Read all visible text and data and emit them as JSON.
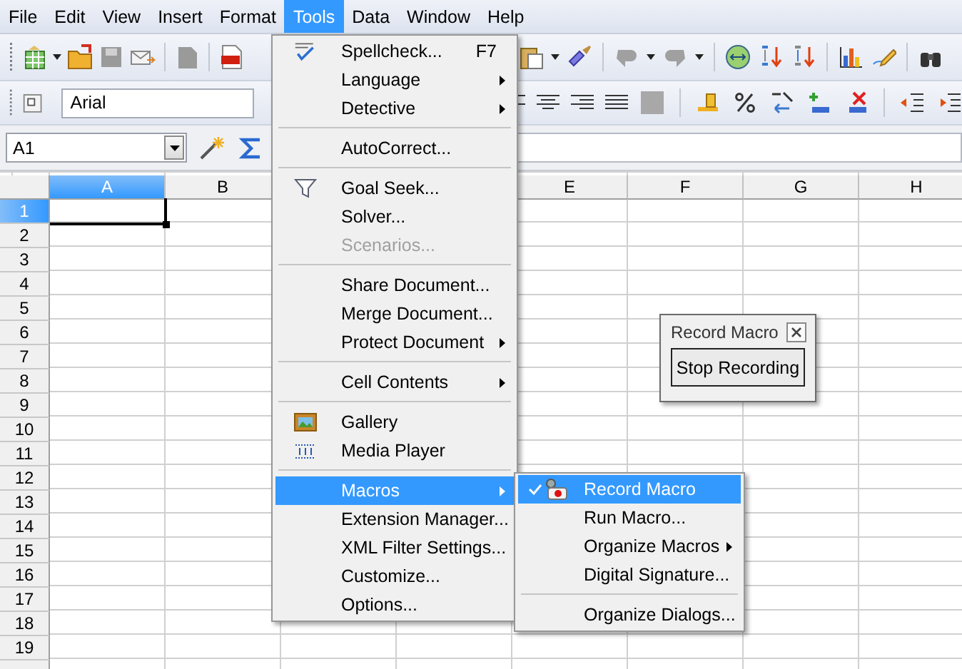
{
  "menubar": [
    {
      "label": "File",
      "selected": false
    },
    {
      "label": "Edit",
      "selected": false
    },
    {
      "label": "View",
      "selected": false
    },
    {
      "label": "Insert",
      "selected": false
    },
    {
      "label": "Format",
      "selected": false
    },
    {
      "label": "Tools",
      "selected": true
    },
    {
      "label": "Data",
      "selected": false
    },
    {
      "label": "Window",
      "selected": false
    },
    {
      "label": "Help",
      "selected": false
    }
  ],
  "font_field": {
    "value": "Arial"
  },
  "name_box": {
    "value": "A1"
  },
  "sheet": {
    "columns": [
      {
        "label": "A",
        "selected": true
      },
      {
        "label": "B",
        "selected": false
      }
    ],
    "columns_right": [
      {
        "label": "E",
        "selected": false
      },
      {
        "label": "F",
        "selected": false
      },
      {
        "label": "G",
        "selected": false
      },
      {
        "label": "H",
        "selected": false
      }
    ],
    "rows": [
      {
        "label": "1",
        "selected": true
      },
      {
        "label": "2",
        "selected": false
      },
      {
        "label": "3",
        "selected": false
      },
      {
        "label": "4",
        "selected": false
      },
      {
        "label": "5",
        "selected": false
      },
      {
        "label": "6",
        "selected": false
      },
      {
        "label": "7",
        "selected": false
      },
      {
        "label": "8",
        "selected": false
      },
      {
        "label": "9",
        "selected": false
      },
      {
        "label": "10",
        "selected": false
      },
      {
        "label": "11",
        "selected": false
      },
      {
        "label": "12",
        "selected": false
      },
      {
        "label": "13",
        "selected": false
      },
      {
        "label": "14",
        "selected": false
      },
      {
        "label": "15",
        "selected": false
      },
      {
        "label": "16",
        "selected": false
      },
      {
        "label": "17",
        "selected": false
      },
      {
        "label": "18",
        "selected": false
      },
      {
        "label": "19",
        "selected": false
      }
    ]
  },
  "tools_menu": {
    "items": [
      {
        "kind": "item",
        "label": "Spellcheck...",
        "shortcut": "F7",
        "submenu": false,
        "disabled": false,
        "selected": false
      },
      {
        "kind": "item",
        "label": "Language",
        "submenu": true,
        "disabled": false,
        "selected": false
      },
      {
        "kind": "item",
        "label": "Detective",
        "submenu": true,
        "disabled": false,
        "selected": false
      },
      {
        "kind": "separator"
      },
      {
        "kind": "item",
        "label": "AutoCorrect...",
        "submenu": false,
        "disabled": false,
        "selected": false
      },
      {
        "kind": "separator"
      },
      {
        "kind": "item",
        "label": "Goal Seek...",
        "submenu": false,
        "disabled": false,
        "selected": false
      },
      {
        "kind": "item",
        "label": "Solver...",
        "submenu": false,
        "disabled": false,
        "selected": false
      },
      {
        "kind": "item",
        "label": "Scenarios...",
        "submenu": false,
        "disabled": true,
        "selected": false
      },
      {
        "kind": "separator"
      },
      {
        "kind": "item",
        "label": "Share Document...",
        "submenu": false,
        "disabled": false,
        "selected": false
      },
      {
        "kind": "item",
        "label": "Merge Document...",
        "submenu": false,
        "disabled": false,
        "selected": false
      },
      {
        "kind": "item",
        "label": "Protect Document",
        "submenu": true,
        "disabled": false,
        "selected": false
      },
      {
        "kind": "separator"
      },
      {
        "kind": "item",
        "label": "Cell Contents",
        "submenu": true,
        "disabled": false,
        "selected": false
      },
      {
        "kind": "separator"
      },
      {
        "kind": "item",
        "label": "Gallery",
        "submenu": false,
        "disabled": false,
        "selected": false
      },
      {
        "kind": "item",
        "label": "Media Player",
        "submenu": false,
        "disabled": false,
        "selected": false
      },
      {
        "kind": "separator"
      },
      {
        "kind": "item",
        "label": "Macros",
        "submenu": true,
        "disabled": false,
        "selected": true
      },
      {
        "kind": "item",
        "label": "Extension Manager...",
        "submenu": false,
        "disabled": false,
        "selected": false
      },
      {
        "kind": "item",
        "label": "XML Filter Settings...",
        "submenu": false,
        "disabled": false,
        "selected": false
      },
      {
        "kind": "item",
        "label": "Customize...",
        "submenu": false,
        "disabled": false,
        "selected": false
      },
      {
        "kind": "item",
        "label": "Options...",
        "submenu": false,
        "disabled": false,
        "selected": false
      }
    ]
  },
  "macros_submenu": {
    "items": [
      {
        "kind": "item",
        "label": "Record Macro",
        "checked": true,
        "submenu": false,
        "selected": true
      },
      {
        "kind": "item",
        "label": "Run Macro...",
        "checked": false,
        "submenu": false,
        "selected": false
      },
      {
        "kind": "item",
        "label": "Organize Macros",
        "checked": false,
        "submenu": true,
        "selected": false
      },
      {
        "kind": "item",
        "label": "Digital Signature...",
        "checked": false,
        "submenu": false,
        "selected": false
      },
      {
        "kind": "separator"
      },
      {
        "kind": "item",
        "label": "Organize Dialogs...",
        "checked": false,
        "submenu": false,
        "selected": false
      }
    ]
  },
  "record_macro_window": {
    "title": "Record Macro",
    "button": "Stop Recording"
  }
}
